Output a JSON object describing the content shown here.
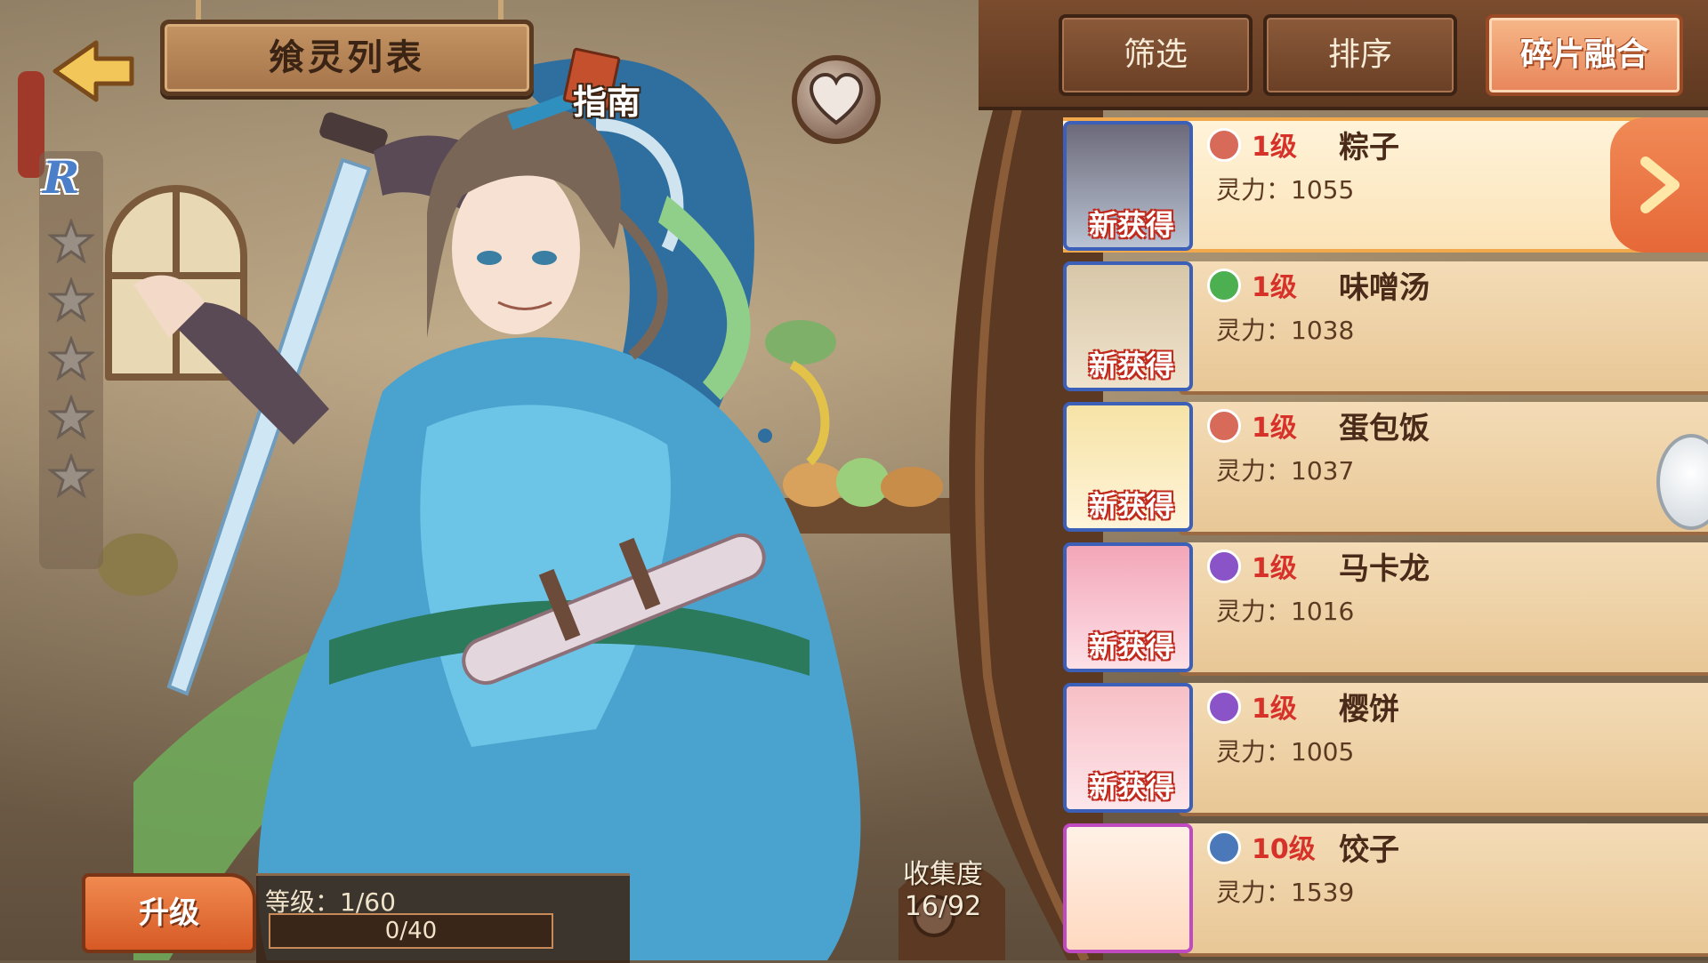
{
  "header": {
    "title": "飨灵列表",
    "guide_label": "指南"
  },
  "rarity": "R",
  "stars_total": 5,
  "stars_filled": 0,
  "upgrade": {
    "button_label": "升级",
    "level_text": "等级：1/60",
    "exp_text": "0/40"
  },
  "collection": {
    "label": "收集度",
    "value": "16/92"
  },
  "toolbar": {
    "filter_label": "筛选",
    "sort_label": "排序",
    "fusion_label": "碎片融合"
  },
  "list": {
    "items": [
      {
        "level": "1级",
        "name": "粽子",
        "power": "灵力：1055",
        "tag": "新获得",
        "type_icon": "attack-icon",
        "type_color": "#d86a5a",
        "frame": "blue",
        "selected": true
      },
      {
        "level": "1级",
        "name": "味噌汤",
        "power": "灵力：1038",
        "tag": "新获得",
        "type_icon": "heal-icon",
        "type_color": "#4caf50",
        "frame": "blue",
        "selected": false
      },
      {
        "level": "1级",
        "name": "蛋包饭",
        "power": "灵力：1037",
        "tag": "新获得",
        "type_icon": "attack-icon",
        "type_color": "#d86a5a",
        "frame": "blue",
        "selected": false
      },
      {
        "level": "1级",
        "name": "马卡龙",
        "power": "灵力：1016",
        "tag": "新获得",
        "type_icon": "magic-icon",
        "type_color": "#8a54c8",
        "frame": "blue",
        "selected": false
      },
      {
        "level": "1级",
        "name": "樱饼",
        "power": "灵力：1005",
        "tag": "新获得",
        "type_icon": "magic-icon",
        "type_color": "#8a54c8",
        "frame": "blue",
        "selected": false
      },
      {
        "level": "10级",
        "name": "饺子",
        "power": "灵力：1539",
        "tag": "",
        "type_icon": "defense-icon",
        "type_color": "#4a78b8",
        "frame": "pink",
        "selected": false
      }
    ]
  },
  "colors": {
    "accent_orange": "#e8855a",
    "wood_dark": "#5e3820",
    "level_red": "#d7322a"
  }
}
